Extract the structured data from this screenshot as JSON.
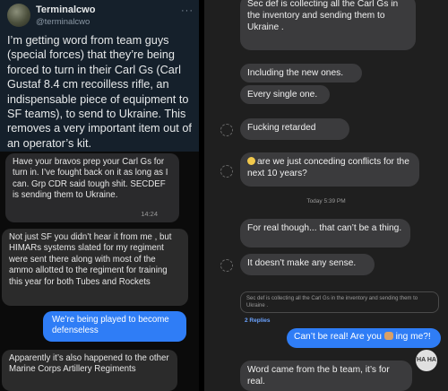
{
  "tweet": {
    "name": "Terminalcwo",
    "handle": "@terminalcwo",
    "more": "···",
    "text": "I’m getting word from team guys (special forces) that they’re being forced to turn in their Carl Gs (Carl Gustaf 8.4 cm recoilless rifle, an indispensable piece of equipment to SF teams), to send to Ukraine. This removes a very important item out of an operator’s kit."
  },
  "left_chat": {
    "msg1": "Have your bravos prep your Carl Gs for turn in. I’ve fought back on it as long as I can. Grp CDR said tough shit. SECDEF is sending them to Ukraine.",
    "msg1_time": "14:24",
    "msg2": "Not just SF you didn’t hear it from me , but HIMARs systems slated for my regiment were sent there along with most of the ammo allotted to the regiment for training this year for both Tubes and Rockets",
    "msg3": "We’re being played to become defenseless",
    "msg4": "Apparently it’s also happened to the other Marine Corps Artillery Regiments"
  },
  "right_chat": {
    "m1": "Sec def is collecting all the Carl Gs in the inventory and sending them to Ukraine .",
    "m2": "Including the new ones.",
    "m3": "Every single one.",
    "m4": "Fucking retarded",
    "m5": "are we just conceding conflicts for the next 10 years?",
    "day_time": "Today 5:39 PM",
    "m6": "For real though... that can’t be a thing.",
    "m7": "It doesn’t make any sense.",
    "thread_quote": "Sec def is collecting all the Carl Gs in the inventory and sending them to Ukraine .",
    "replies": "2 Replies",
    "m8_a": "Can’t be real! Are you",
    "m8_b": "ing me?!",
    "m9": "Word came from the b team, it’s for real.",
    "badge": "HA HA"
  }
}
